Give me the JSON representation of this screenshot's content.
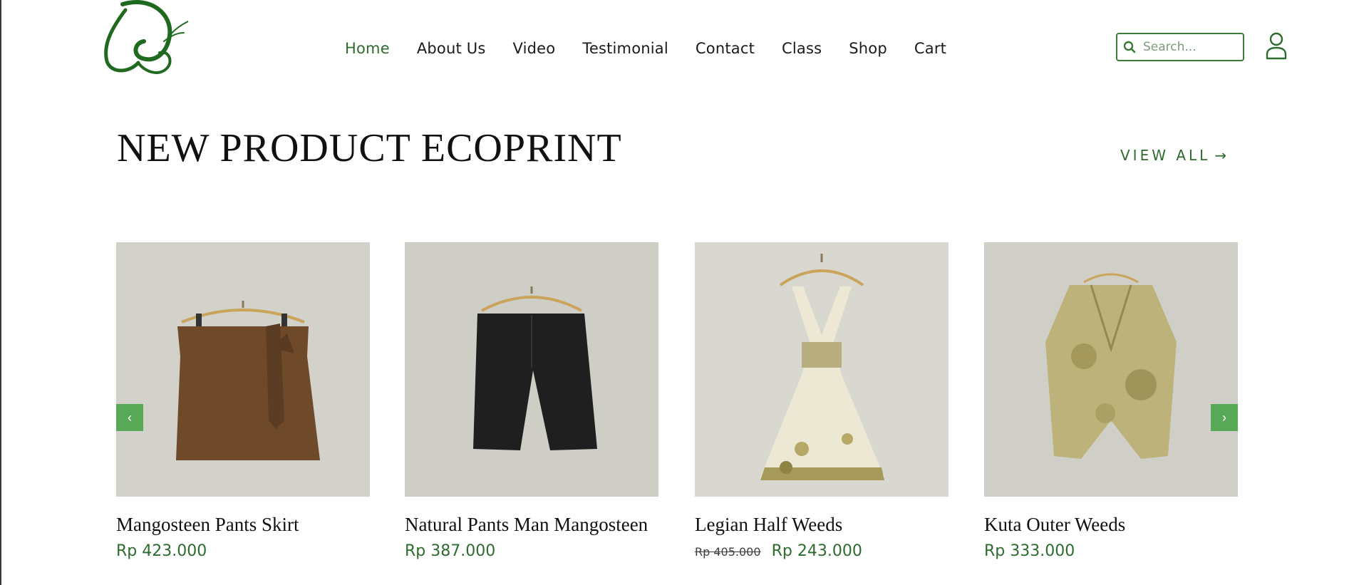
{
  "header": {
    "logo_name": "butterfly-logo",
    "nav": [
      {
        "label": "Home",
        "active": true
      },
      {
        "label": "About Us"
      },
      {
        "label": "Video"
      },
      {
        "label": "Testimonial"
      },
      {
        "label": "Contact"
      },
      {
        "label": "Class"
      },
      {
        "label": "Shop"
      },
      {
        "label": "Cart"
      }
    ],
    "search": {
      "placeholder": "Search...",
      "value": ""
    }
  },
  "section": {
    "title": "NEW PRODUCT ECOPRINT",
    "view_all": "VIEW ALL",
    "view_all_arrow": "→"
  },
  "carousel": {
    "prev_icon": "‹",
    "next_icon": "›"
  },
  "products": [
    {
      "name": "Mangosteen Pants Skirt",
      "price": "Rp 423.000",
      "old_price": ""
    },
    {
      "name": "Natural Pants Man Mangosteen",
      "price": "Rp 387.000",
      "old_price": ""
    },
    {
      "name": "Legian Half Weeds",
      "price": "Rp 243.000",
      "old_price": "Rp 405.000"
    },
    {
      "name": "Kuta Outer Weeds",
      "price": "Rp 333.000",
      "old_price": ""
    }
  ],
  "colors": {
    "accent": "#2e6b2e",
    "button": "#57a857",
    "photo_bg": "#d3d2cb"
  }
}
